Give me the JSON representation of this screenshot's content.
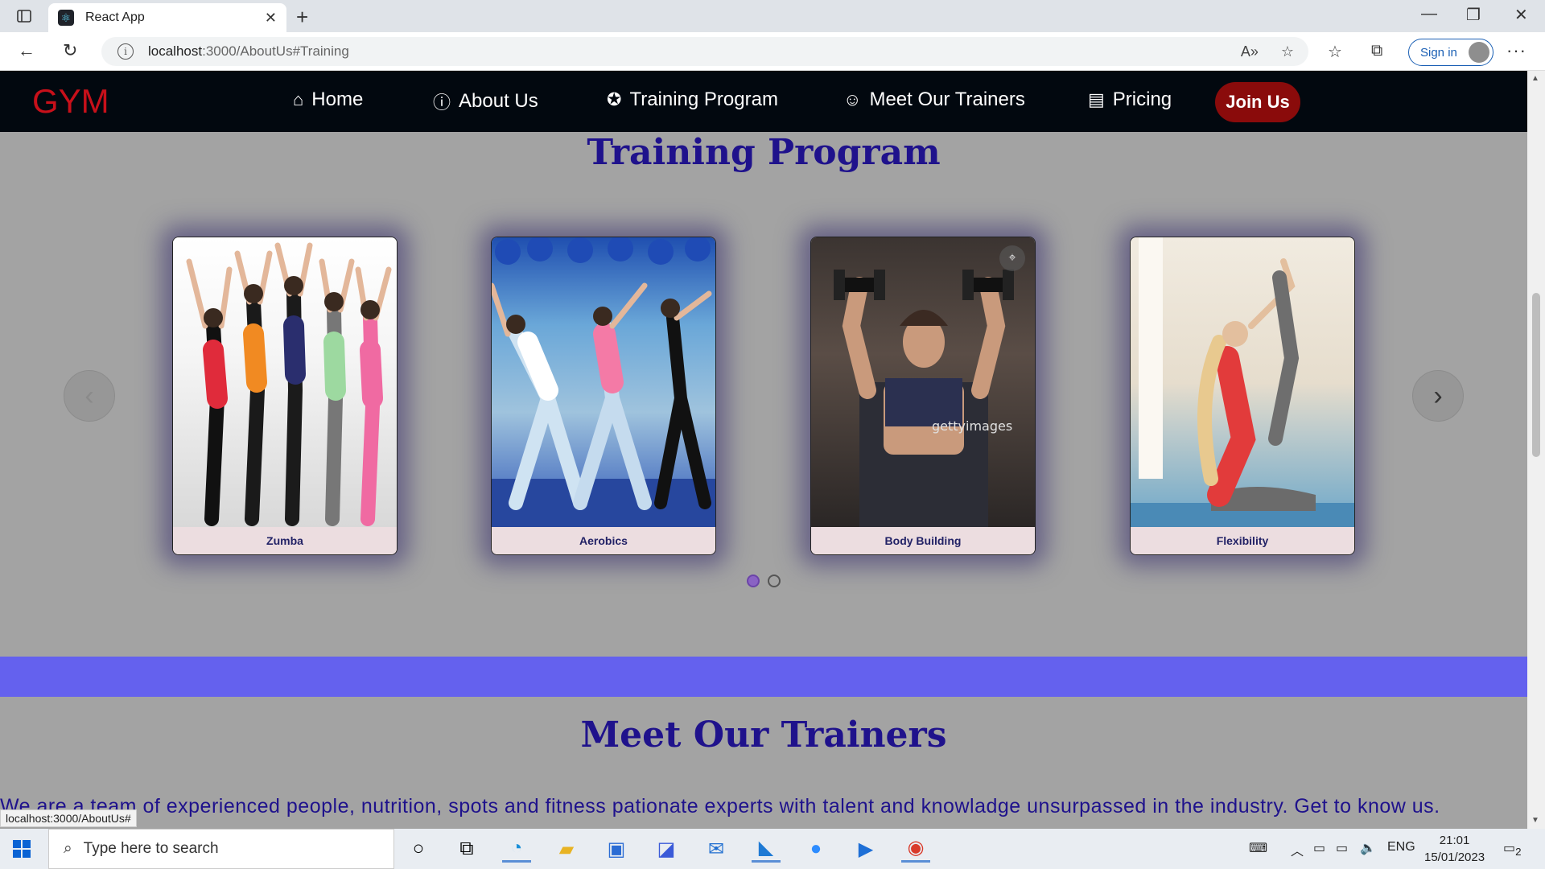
{
  "browser": {
    "tab_title": "React App",
    "url_host": "localhost",
    "url_rest": ":3000/AboutUs#Training",
    "signin_label": "Sign in",
    "status_url": "localhost:3000/AboutUs#"
  },
  "navbar": {
    "brand": "GYM",
    "items": [
      {
        "label": "Home",
        "icon": "home-icon"
      },
      {
        "label": "About Us",
        "icon": "info-icon"
      },
      {
        "label": "Training Program",
        "icon": "training-icon"
      },
      {
        "label": "Meet Our Trainers",
        "icon": "trainer-icon"
      },
      {
        "label": "Pricing",
        "icon": "pricing-icon"
      }
    ],
    "join_label": "Join Us"
  },
  "training": {
    "title": "Training Program",
    "cards": [
      {
        "label": "Zumba"
      },
      {
        "label": "Aerobics"
      },
      {
        "label": "Body Building"
      },
      {
        "label": "Flexibility"
      }
    ],
    "prev_arrow": "‹",
    "next_arrow": "›",
    "pages": 2,
    "active_page": 1
  },
  "trainers": {
    "title": "Meet Our Trainers",
    "intro": "We are a team of experienced people, nutrition, spots and fitness pationate experts with talent and knowladge unsurpassed in the industry. Get to know us."
  },
  "taskbar": {
    "search_placeholder": "Type here to search",
    "lang": "ENG",
    "time": "21:01",
    "date": "15/01/2023",
    "notification_count": "2"
  },
  "colors": {
    "brand_red": "#c8101a",
    "title_blue": "#1f128c",
    "join_button": "#8a0b0b",
    "band": "#6461ee"
  }
}
